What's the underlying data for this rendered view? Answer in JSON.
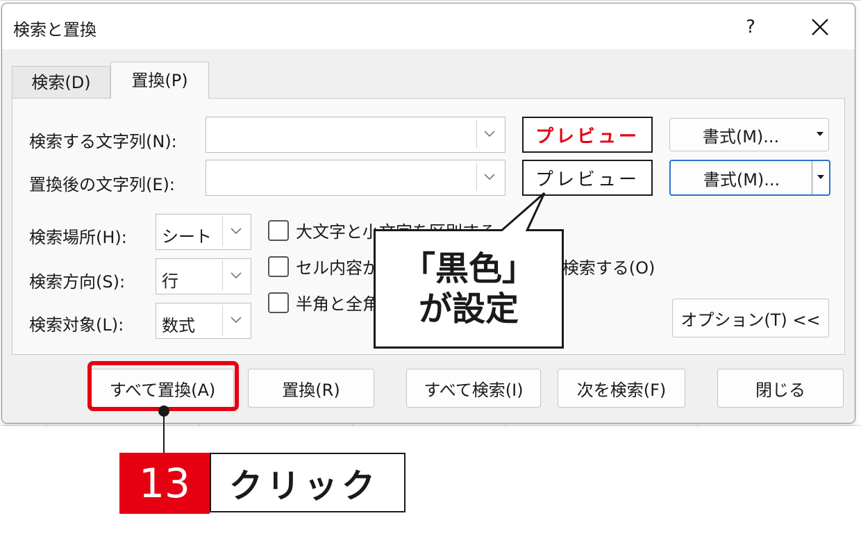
{
  "dialog": {
    "title": "検索と置換",
    "help_label": "?",
    "tabs": [
      {
        "label": "検索(D)"
      },
      {
        "label": "置換(P)"
      }
    ],
    "find": {
      "label": "検索する文字列(N):",
      "value": "",
      "preview": "プレビュー",
      "format_button": "書式(M)..."
    },
    "replace": {
      "label": "置換後の文字列(E):",
      "value": "",
      "preview": "プレビュー",
      "format_button": "書式(M)..."
    },
    "search_in": {
      "label": "検索場所(H):",
      "value": "シート"
    },
    "search_dir": {
      "label": "検索方向(S):",
      "value": "行"
    },
    "search_target": {
      "label": "検索対象(L):",
      "value": "数式"
    },
    "checkboxes": [
      {
        "label": "大文字と小文字を区別する",
        "checked": false
      },
      {
        "label": "セル内容が完全に同一であるものを検索する(O)",
        "checked": false
      },
      {
        "label": "半角と全角を区別する",
        "checked": false
      }
    ],
    "options_button": "オプション(T) <<",
    "buttons": {
      "replace_all": "すべて置換(A)",
      "replace": "置換(R)",
      "find_all": "すべて検索(I)",
      "find_next": "次を検索(F)",
      "close": "閉じる"
    }
  },
  "annotation": {
    "callout_line1": "「黒色」",
    "callout_line2": "が設定",
    "step_number": "13",
    "step_text": "クリック"
  },
  "colors": {
    "accent_red": "#e60012",
    "focus_blue": "#2f6fcf"
  }
}
